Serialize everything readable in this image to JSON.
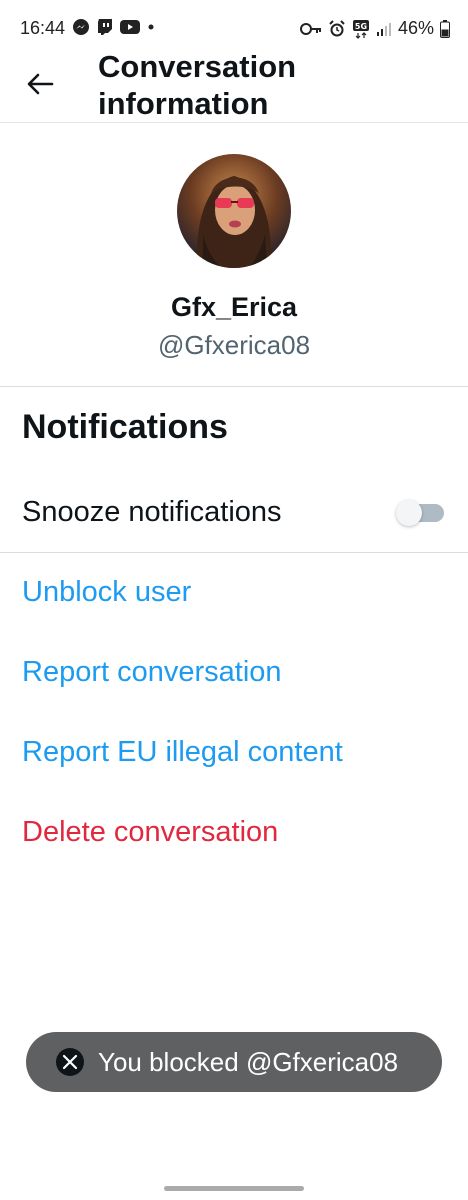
{
  "status_bar": {
    "time": "16:44",
    "left_icons": [
      "messenger-icon",
      "twitch-icon",
      "youtube-icon",
      "dot-icon"
    ],
    "right_icons": [
      "vpn-key-icon",
      "alarm-icon",
      "5g-icon",
      "signal-icon",
      "battery-icon"
    ],
    "network": "5G",
    "battery": "46%"
  },
  "header": {
    "title": "Conversation information",
    "back_icon": "arrow-left-icon"
  },
  "profile": {
    "display_name": "Gfx_Erica",
    "handle": "@Gfxerica08"
  },
  "notifications": {
    "section_title": "Notifications",
    "snooze_label": "Snooze notifications",
    "snooze_enabled": false
  },
  "actions": [
    {
      "label": "Unblock user",
      "color": "#1d9bf0"
    },
    {
      "label": "Report conversation",
      "color": "#1d9bf0"
    },
    {
      "label": "Report EU illegal content",
      "color": "#1d9bf0"
    },
    {
      "label": "Delete conversation",
      "color": "#e0283e"
    }
  ],
  "toast": {
    "icon": "x-logo-icon",
    "message": "You blocked @Gfxerica08"
  },
  "colors": {
    "accent": "#1d9bf0",
    "danger": "#e0283e",
    "text": "#0f1419",
    "secondary_text": "#536471",
    "toast_bg": "#5e6062"
  }
}
